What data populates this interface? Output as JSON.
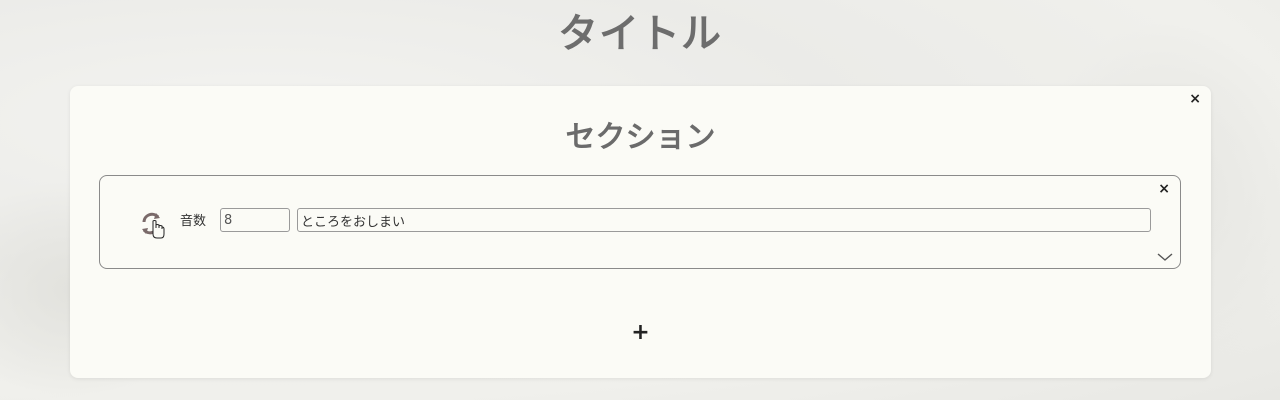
{
  "page": {
    "title": "タイトル"
  },
  "section": {
    "title": "セクション",
    "close_label": "×",
    "add_label": "+"
  },
  "item": {
    "close_label": "×",
    "syllable_label": "音数",
    "syllable_value": "8",
    "text_value": "ところをおしまい",
    "reload_icon": "reload-icon",
    "expand_icon": "chevron-down-icon"
  }
}
